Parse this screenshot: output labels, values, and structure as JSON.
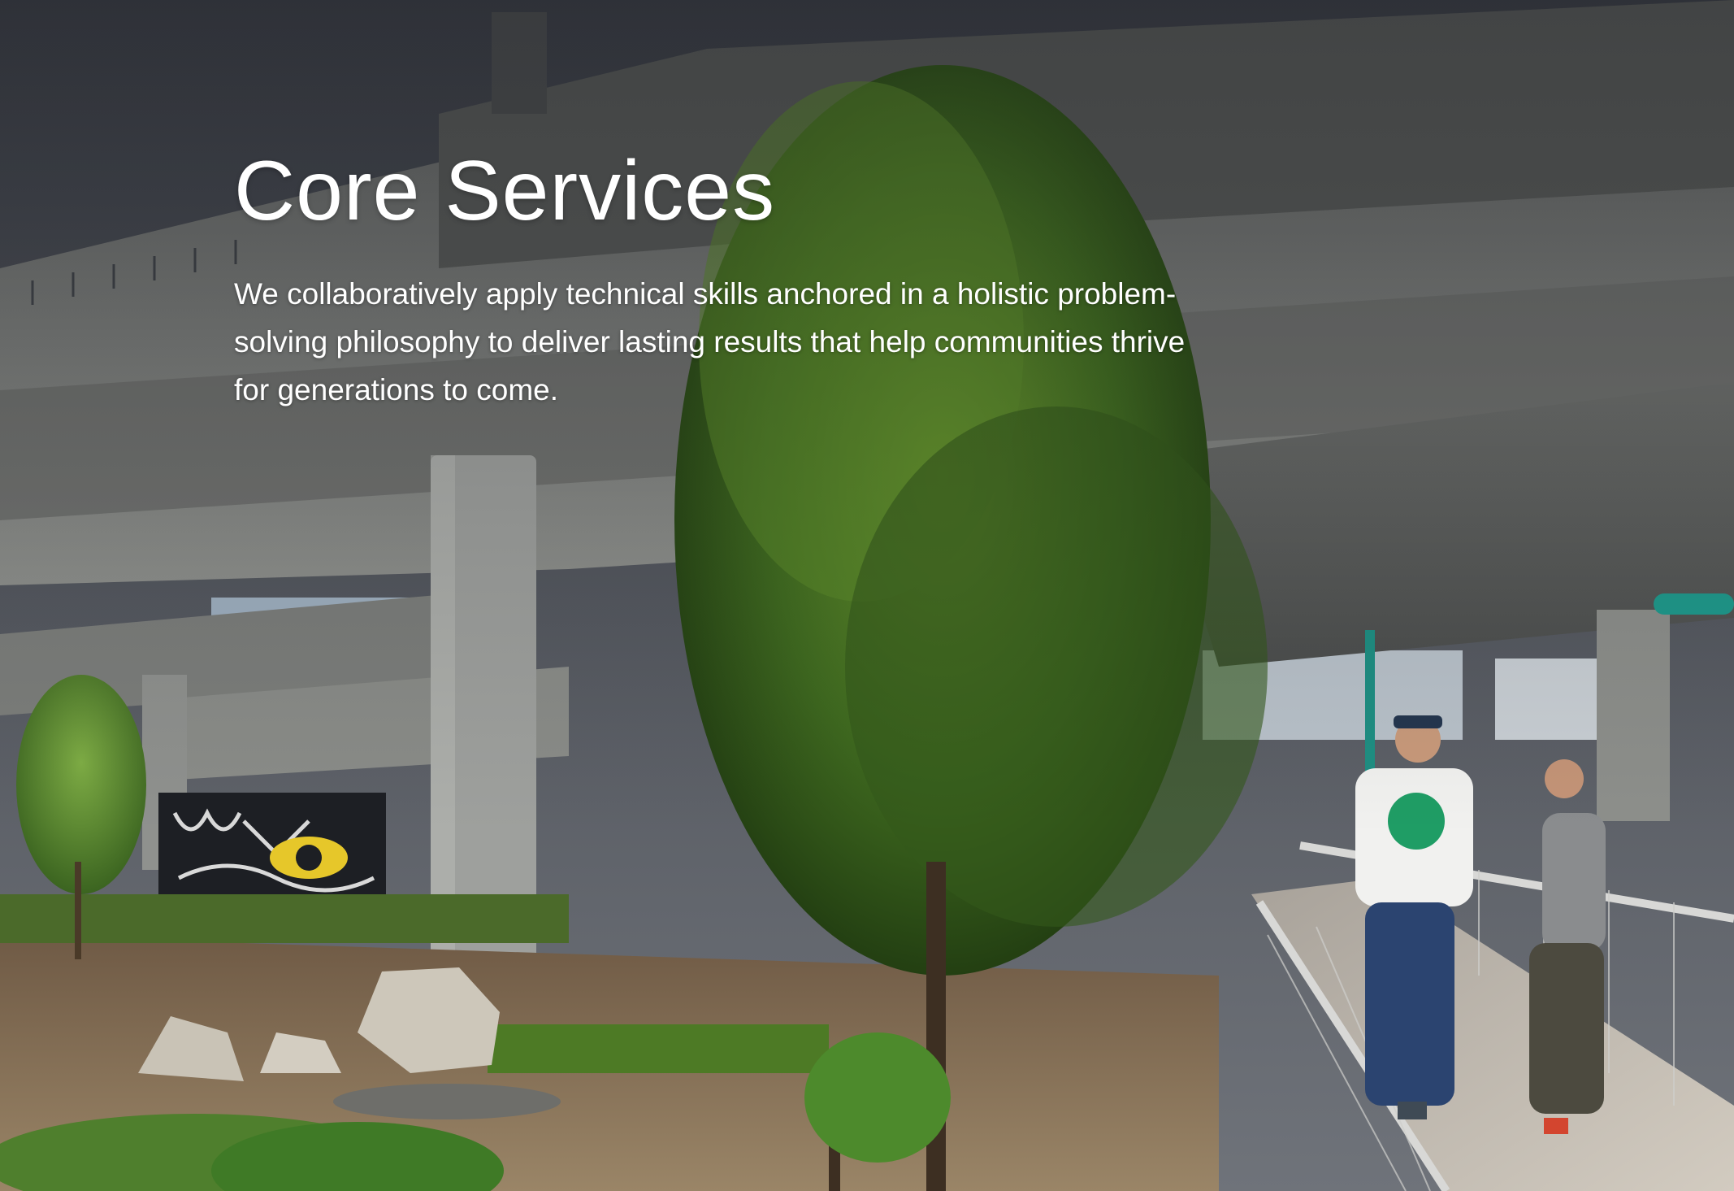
{
  "hero": {
    "title": "Core Services",
    "description": "We collaboratively apply technical skills anchored in a holistic problem-solving philosophy to deliver lasting results that help communities thrive for generations to come."
  },
  "colors": {
    "heading_text": "#ffffff",
    "body_text": "#ffffff",
    "sky": "#4a4f58",
    "concrete": "#8f918e",
    "foliage": "#3f6a1f"
  }
}
